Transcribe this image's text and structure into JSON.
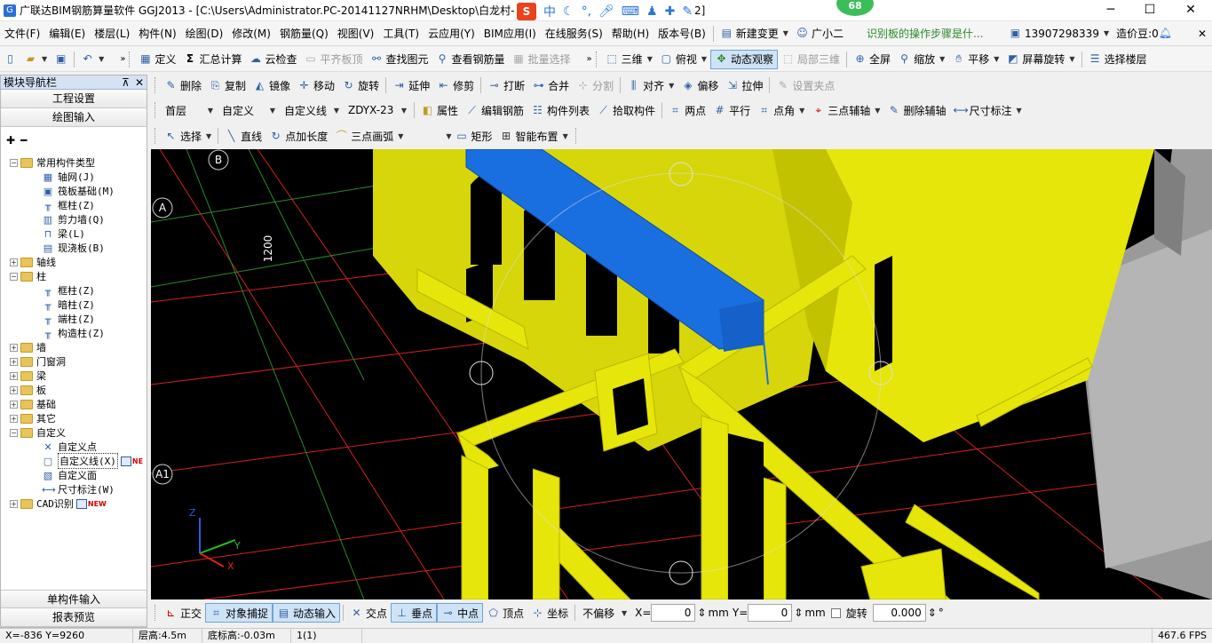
{
  "window": {
    "title": "广联达BIM钢筋算量软件 GGJ2013 - [C:\\Users\\Administrator.PC-20141127NRHM\\Desktop\\白龙村-",
    "title_suffix": "2]",
    "minimize": "─",
    "maximize": "☐",
    "close": "✕",
    "notification_count": "68"
  },
  "ime": {
    "logo": "S",
    "mode": "中"
  },
  "menubar": {
    "items": [
      "文件(F)",
      "编辑(E)",
      "楼层(L)",
      "构件(N)",
      "绘图(D)",
      "修改(M)",
      "钢筋量(Q)",
      "视图(V)",
      "工具(T)",
      "云应用(Y)",
      "BIM应用(I)",
      "在线服务(S)",
      "帮助(H)",
      "版本号(B)"
    ],
    "new_change": "新建变更",
    "assistant": "广小二",
    "tip": "识别板的操作步骤是什...",
    "account": "13907298339",
    "coins": "造价豆:0"
  },
  "toolbar1": {
    "define": "定义",
    "calc": "汇总计算",
    "cloud_check": "云检查",
    "align_top": "平齐板顶",
    "find": "查找图元",
    "view_rebar": "查看钢筋量",
    "batch_select": "批量选择",
    "three_d": "三维",
    "top_view": "俯视",
    "dynamic_view": "动态观察",
    "local_3d": "局部三维",
    "full_screen": "全屏",
    "zoom": "缩放",
    "pan": "平移",
    "rotate_screen": "屏幕旋转",
    "select_floor": "选择楼层"
  },
  "toolbar2": {
    "delete": "删除",
    "copy": "复制",
    "mirror": "镜像",
    "move": "移动",
    "rotate": "旋转",
    "extend": "延伸",
    "trim": "修剪",
    "break": "打断",
    "merge": "合并",
    "split": "分割",
    "align": "对齐",
    "offset": "偏移",
    "stretch": "拉伸",
    "set_grip": "设置夹点"
  },
  "toolbar3": {
    "floor": "首层",
    "category": "自定义",
    "type": "自定义线",
    "name": "ZDYX-23",
    "properties": "属性",
    "edit_rebar": "编辑钢筋",
    "component_list": "构件列表",
    "pick": "拾取构件",
    "two_point": "两点",
    "parallel": "平行",
    "point_angle": "点角",
    "three_point_axis": "三点辅轴",
    "delete_axis": "删除辅轴",
    "dimension": "尺寸标注"
  },
  "toolbar4": {
    "select": "选择",
    "line": "直线",
    "point_length": "点加长度",
    "arc": "三点画弧",
    "rect": "矩形",
    "smart": "智能布置"
  },
  "leftpanel": {
    "title": "模块导航栏",
    "pin": "⊼",
    "close": "✕",
    "project_settings": "工程设置",
    "drawing_input": "绘图输入",
    "single_input": "单构件输入",
    "report_preview": "报表预览",
    "tree": [
      {
        "label": "常用构件类型",
        "level": 0,
        "expanded": true,
        "folder": true
      },
      {
        "label": "轴网(J)",
        "level": 1,
        "icon": "grid-icon"
      },
      {
        "label": "筏板基础(M)",
        "level": 1,
        "icon": "raft-icon"
      },
      {
        "label": "框柱(Z)",
        "level": 1,
        "icon": "column-icon"
      },
      {
        "label": "剪力墙(Q)",
        "level": 1,
        "icon": "wall-icon"
      },
      {
        "label": "梁(L)",
        "level": 1,
        "icon": "beam-icon"
      },
      {
        "label": "现浇板(B)",
        "level": 1,
        "icon": "slab-icon"
      },
      {
        "label": "轴线",
        "level": 0,
        "expanded": false,
        "folder": true
      },
      {
        "label": "柱",
        "level": 0,
        "expanded": true,
        "folder": true
      },
      {
        "label": "框柱(Z)",
        "level": 1,
        "icon": "column-icon"
      },
      {
        "label": "暗柱(Z)",
        "level": 1,
        "icon": "column-icon"
      },
      {
        "label": "端柱(Z)",
        "level": 1,
        "icon": "column-icon"
      },
      {
        "label": "构造柱(Z)",
        "level": 1,
        "icon": "column-icon"
      },
      {
        "label": "墙",
        "level": 0,
        "expanded": false,
        "folder": true
      },
      {
        "label": "门窗洞",
        "level": 0,
        "expanded": false,
        "folder": true
      },
      {
        "label": "梁",
        "level": 0,
        "expanded": false,
        "folder": true
      },
      {
        "label": "板",
        "level": 0,
        "expanded": false,
        "folder": true
      },
      {
        "label": "基础",
        "level": 0,
        "expanded": false,
        "folder": true
      },
      {
        "label": "其它",
        "level": 0,
        "expanded": false,
        "folder": true
      },
      {
        "label": "自定义",
        "level": 0,
        "expanded": true,
        "folder": true
      },
      {
        "label": "自定义点",
        "level": 1,
        "icon": "point-icon"
      },
      {
        "label": "自定义线(X)",
        "level": 1,
        "icon": "line-icon",
        "selected": true,
        "badge": "NE"
      },
      {
        "label": "自定义面",
        "level": 1,
        "icon": "face-icon"
      },
      {
        "label": "尺寸标注(W)",
        "level": 1,
        "icon": "dimension-icon"
      },
      {
        "label": "CAD识别",
        "level": 0,
        "expanded": false,
        "folder": true,
        "badge": "NEW"
      }
    ]
  },
  "viewport": {
    "axis_labels": [
      "B",
      "A",
      "A1"
    ],
    "dimension_text": "1200",
    "gizmo": {
      "x": "X",
      "y": "Y",
      "z": "Z"
    },
    "colors": {
      "background": "#000000",
      "member": "#e6e60a",
      "selected": "#1a6fe0",
      "wall": "#b5b5b5",
      "grid_red": "#d42020",
      "grid_green": "#2a8a2a"
    }
  },
  "snapbar": {
    "ortho": "正交",
    "object_snap": "对象捕捉",
    "dynamic_input": "动态输入",
    "intersection": "交点",
    "perpendicular": "垂点",
    "midpoint": "中点",
    "vertex": "顶点",
    "coordinate": "坐标",
    "offset_mode": "不偏移",
    "x_label": "X=",
    "x_value": "0",
    "y_label": "Y=",
    "y_value": "0",
    "unit": "mm",
    "rotate_label": "旋转",
    "rotate_value": "0.000",
    "degree": "°"
  },
  "statusbar": {
    "coords": "X=-836 Y=9260",
    "floor_height": "层高:4.5m",
    "bottom_elev": "底标高:-0.03m",
    "selection": "1(1)",
    "fps": "467.6 FPS"
  }
}
